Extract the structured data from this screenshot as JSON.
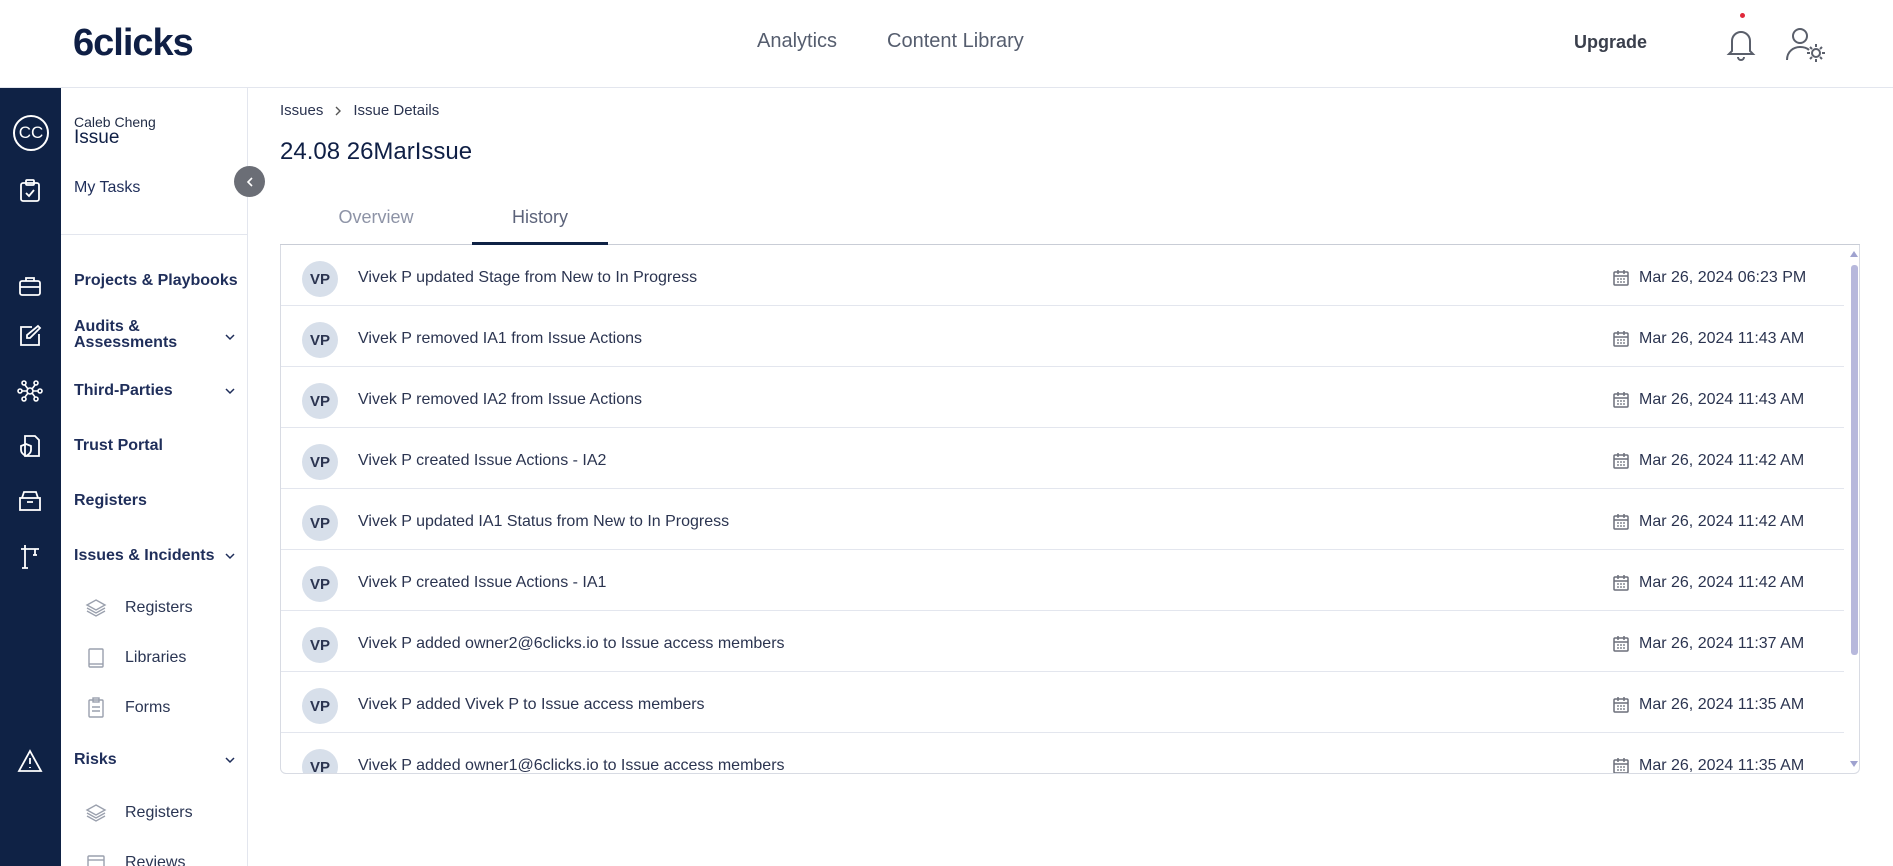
{
  "brand": {
    "logo": "6clicks"
  },
  "topnav": {
    "items": [
      "Analytics",
      "Content Library"
    ],
    "upgrade": "Upgrade"
  },
  "rail": {
    "avatar_initials": "CC"
  },
  "sidebar": {
    "user_name": "Caleb Cheng",
    "context": "Issue",
    "my_tasks": "My Tasks",
    "items": [
      {
        "label": "Projects & Playbooks"
      },
      {
        "label": "Audits & Assessments"
      },
      {
        "label": "Third-Parties"
      },
      {
        "label": "Trust Portal"
      },
      {
        "label": "Registers"
      },
      {
        "label": "Issues & Incidents"
      },
      {
        "label": "Risks"
      }
    ],
    "issues_sub": [
      "Registers",
      "Libraries",
      "Forms"
    ],
    "risks_sub": [
      "Registers",
      "Reviews"
    ]
  },
  "breadcrumb": {
    "root": "Issues",
    "current": "Issue Details"
  },
  "page": {
    "title": "24.08 26MarIssue"
  },
  "tabs": {
    "overview": "Overview",
    "history": "History"
  },
  "history": [
    {
      "initials": "VP",
      "text": "Vivek P updated Stage from New to In Progress",
      "time": "Mar 26, 2024 06:23 PM"
    },
    {
      "initials": "VP",
      "text": "Vivek P removed IA1 from Issue Actions",
      "time": "Mar 26, 2024 11:43 AM"
    },
    {
      "initials": "VP",
      "text": "Vivek P removed IA2 from Issue Actions",
      "time": "Mar 26, 2024 11:43 AM"
    },
    {
      "initials": "VP",
      "text": "Vivek P created Issue Actions - IA2",
      "time": "Mar 26, 2024 11:42 AM"
    },
    {
      "initials": "VP",
      "text": "Vivek P updated IA1 Status from New to In Progress",
      "time": "Mar 26, 2024 11:42 AM"
    },
    {
      "initials": "VP",
      "text": "Vivek P created Issue Actions - IA1",
      "time": "Mar 26, 2024 11:42 AM"
    },
    {
      "initials": "VP",
      "text": "Vivek P added owner2@6clicks.io to Issue access members",
      "time": "Mar 26, 2024 11:37 AM"
    },
    {
      "initials": "VP",
      "text": "Vivek P added Vivek P to Issue access members",
      "time": "Mar 26, 2024 11:35 AM"
    },
    {
      "initials": "VP",
      "text": "Vivek P added owner1@6clicks.io to Issue access members",
      "time": "Mar 26, 2024 11:35 AM"
    }
  ]
}
